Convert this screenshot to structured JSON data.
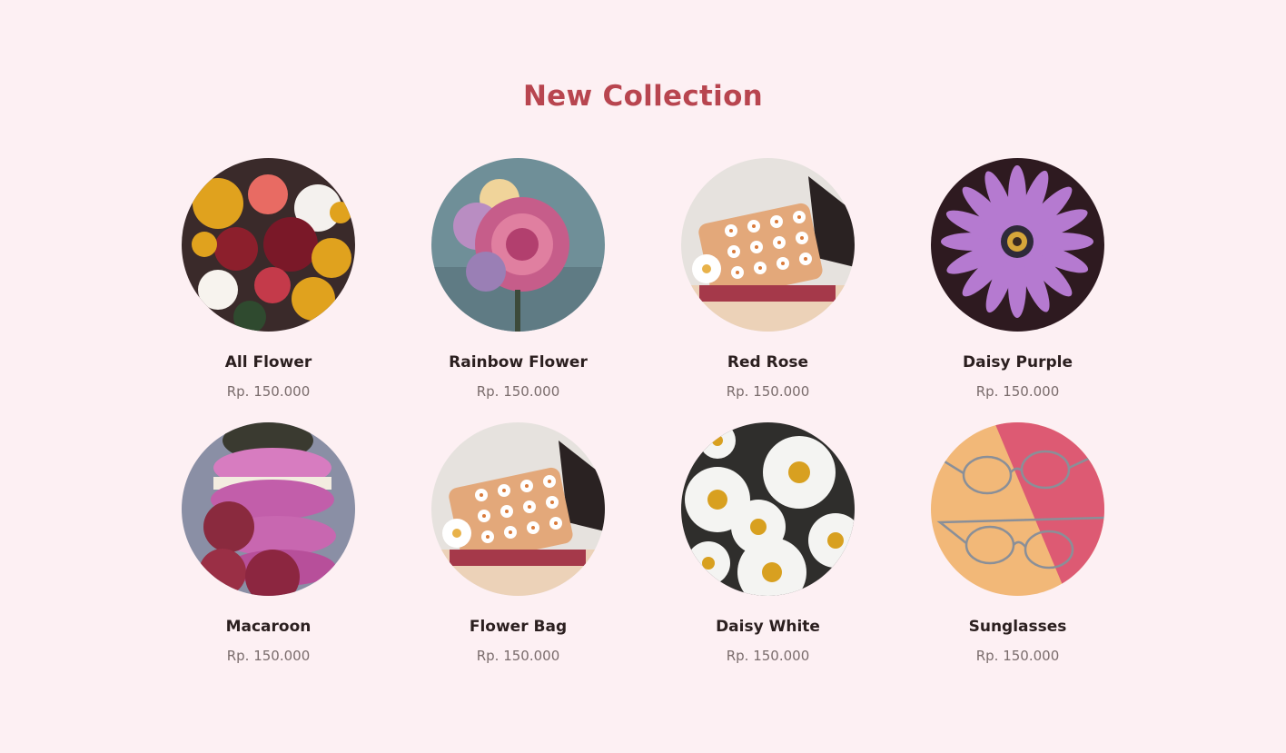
{
  "section": {
    "title": "New Collection"
  },
  "products": [
    {
      "name": "All Flower",
      "price": "Rp. 150.000",
      "image_icon": "flower-bouquet-image"
    },
    {
      "name": "Rainbow Flower",
      "price": "Rp. 150.000",
      "image_icon": "rainbow-rose-image"
    },
    {
      "name": "Red Rose",
      "price": "Rp. 150.000",
      "image_icon": "flower-bag-image"
    },
    {
      "name": "Daisy Purple",
      "price": "Rp. 150.000",
      "image_icon": "purple-daisy-image"
    },
    {
      "name": "Macaroon",
      "price": "Rp. 150.000",
      "image_icon": "macaroon-image"
    },
    {
      "name": "Flower Bag",
      "price": "Rp. 150.000",
      "image_icon": "flower-bag-image"
    },
    {
      "name": "Daisy White",
      "price": "Rp. 150.000",
      "image_icon": "white-daisies-image"
    },
    {
      "name": "Sunglasses",
      "price": "Rp. 150.000",
      "image_icon": "sunglasses-image"
    }
  ],
  "colors": {
    "background": "#fdf0f3",
    "title": "#b8454f",
    "product_name": "#2b1f1f",
    "price": "#7a6c6c"
  }
}
